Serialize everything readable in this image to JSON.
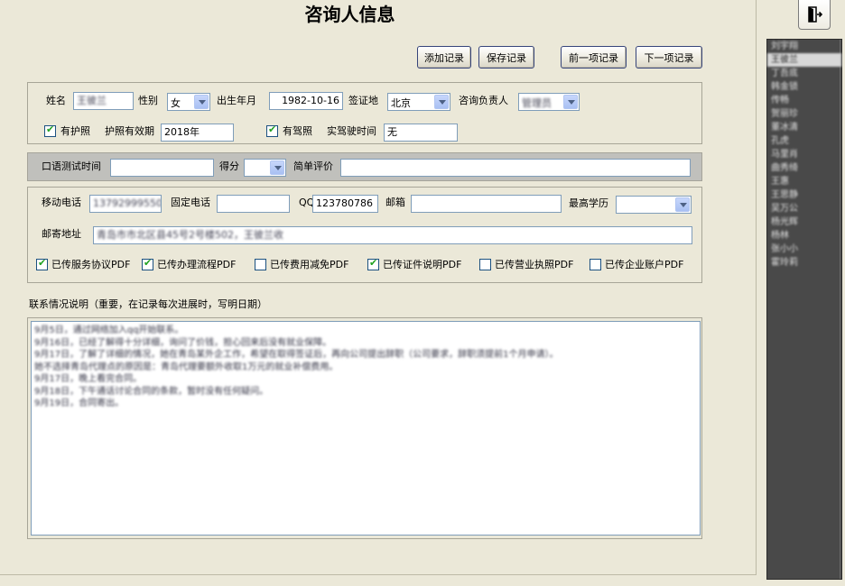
{
  "title": "咨询人信息",
  "toolbar": {
    "add": "添加记录",
    "save": "保存记录",
    "prev": "前一项记录",
    "next": "下一项记录"
  },
  "basic": {
    "name_label": "姓名",
    "name_value": "王彼兰",
    "gender_label": "性别",
    "gender_value": "女",
    "birth_label": "出生年月",
    "birth_value": "1982-10-16",
    "visa_label": "签证地",
    "visa_value": "北京",
    "advisor_label": "咨询负责人",
    "advisor_value": "管理员",
    "passport_label": "有护照",
    "passport_checked": true,
    "passport_expiry_label": "护照有效期",
    "passport_expiry_value": "2018年",
    "license_label": "有驾照",
    "license_checked": true,
    "driving_time_label": "实驾驶时间",
    "driving_time_value": "无"
  },
  "oral": {
    "time_label": "口语测试时间",
    "time_value": "",
    "score_label": "得分",
    "score_value": "",
    "eval_label": "简单评价",
    "eval_value": ""
  },
  "contact": {
    "mobile_label": "移动电话",
    "mobile_value": "13792999550",
    "phone_label": "固定电话",
    "phone_value": "",
    "qq_label": "QQ",
    "qq_value": "123780786",
    "email_label": "邮箱",
    "email_value": "",
    "edu_label": "最高学历",
    "edu_value": "",
    "address_label": "邮寄地址",
    "address_value": "青岛市市北区县45号2号楼502，王彼兰收"
  },
  "uploads": [
    {
      "label": "已传服务协议PDF",
      "checked": true
    },
    {
      "label": "已传办理流程PDF",
      "checked": true
    },
    {
      "label": "已传费用减免PDF",
      "checked": false
    },
    {
      "label": "已传证件说明PDF",
      "checked": true
    },
    {
      "label": "已传营业执照PDF",
      "checked": false
    },
    {
      "label": "已传企业账户PDF",
      "checked": false
    }
  ],
  "notes": {
    "label": "联系情况说明（重要，在记录每次进展时，写明日期）",
    "lines": [
      "9月5日，通过网络加入qq开始联系。",
      "9月16日，已经了解得十分详细，询问了价钱，担心回来后没有就业保障。",
      "9月17日，了解了详细的情况，她在青岛某外企工作，希望在取得签证后，再向公司提出辞职（公司要求，辞职须提前1个月申请）。",
      "她不选择青岛代理点的原因是：青岛代理要额外收取1万元的就业补偿费用。",
      "9月17日，晚上看完合同。",
      "9月18日，下午通话讨论合同的条款，暂时没有任何疑问。",
      "9月19日，合同寄出。"
    ]
  },
  "sidebar": {
    "items": [
      "刘宇翔",
      "王彼兰",
      "丁吾底",
      "韩金锁",
      "传畅",
      "贺丽珍",
      "董冰清",
      "孔虎",
      "马里肖",
      "曲秀绮",
      "王惠",
      "王思静",
      "吴万公",
      "杨光辉",
      "杨林",
      "张小小",
      "霍玲莉"
    ],
    "selected_index": 1
  },
  "icons": {
    "exit": "exit-door-icon",
    "dropdown": "chevron-down-icon",
    "check": "checkmark-icon"
  }
}
